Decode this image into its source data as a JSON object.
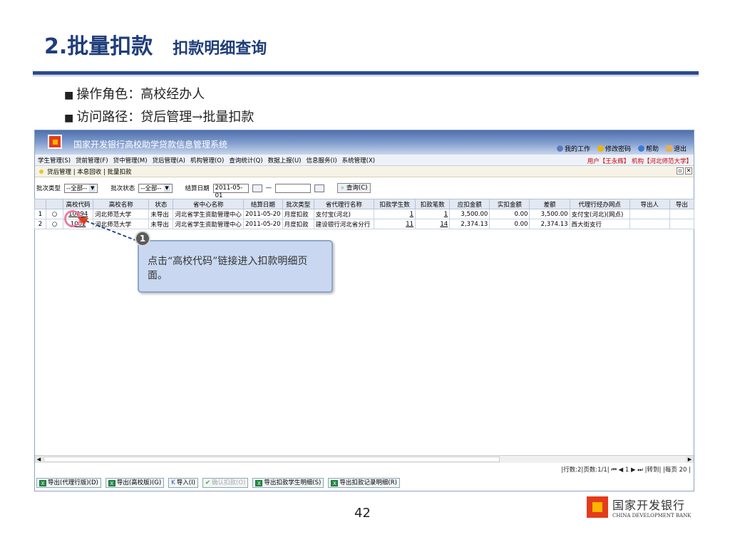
{
  "slide": {
    "title_main": "2.批量扣款",
    "title_sub": "扣款明细查询",
    "bullet1": "操作角色：高校经办人",
    "bullet2": "访问路径：贷后管理→批量扣款",
    "bullet_marker": "■",
    "page_number": "42",
    "brand_cn": "国家开发银行",
    "brand_en": "CHINA DEVELOPMENT BANK"
  },
  "app": {
    "title": "国家开发银行高校助学贷款信息管理系统",
    "tools": [
      "我的工作",
      "修改密码",
      "帮助",
      "退出"
    ],
    "menu": [
      "学生管理(S)",
      "贷前管理(F)",
      "贷中管理(M)",
      "贷后管理(A)",
      "机构管理(O)",
      "查询统计(Q)",
      "数据上报(U)",
      "信息服务(I)",
      "系统管理(X)"
    ],
    "user": "用户【王永辉】 机构【河北师范大学】",
    "breadcrumb": "贷后管理 | 本息回收 | 批量扣款",
    "filter": {
      "batch_type_label": "批次类型",
      "batch_type_value": "--全部--",
      "batch_status_label": "批次状态",
      "batch_status_value": "--全部--",
      "settle_date_label": "结算日期",
      "date_from": "2011-05-01",
      "date_sep": "—",
      "date_to": "",
      "query_button": "查询(C)"
    },
    "table": {
      "headers": [
        "",
        "",
        "高校代码",
        "高校名称",
        "状态",
        "省中心名称",
        "结算日期",
        "批次类型",
        "省代理行名称",
        "扣款学生数",
        "扣款笔数",
        "应扣金额",
        "实扣金额",
        "差额",
        "代理行经办网点",
        "导出人",
        "导出"
      ],
      "rows": [
        [
          "1",
          "10094",
          "河北师范大学",
          "未导出",
          "河北省学生资助管理中心",
          "2011-05-20",
          "月度扣款",
          "支付宝(河北)",
          "1",
          "1",
          "3,500.00",
          "0.00",
          "3,500.00",
          "支付宝(河北)(网点)",
          "",
          ""
        ],
        [
          "2",
          "1002",
          "河北师范大学",
          "未导出",
          "河北省学生资助管理中心",
          "2011-05-20",
          "月度扣款",
          "建设银行河北省分行",
          "11",
          "14",
          "2,374.13",
          "0.00",
          "2,374.13",
          "西大街支行",
          "",
          ""
        ]
      ]
    },
    "pager": "|行数:2|页数:1/1|  ⏮ ◀ 1 ▶ ⏭  |转到|  |每页 20 |",
    "footer_buttons": [
      "导出(代理行版)(D)",
      "导出(高校版)(G)",
      "导入(I)",
      "确认扣款(O)",
      "导出扣款学生明细(S)",
      "导出扣款记录明细(R)"
    ]
  },
  "callout": {
    "number": "1",
    "text": "点击“高校代码”链接进入扣款明细页面。"
  },
  "colors": {
    "title": "#1f3d7a",
    "rule": "#2b4b8c",
    "callout_bg": "#c9d8f0",
    "highlight": "#e87fa0"
  }
}
